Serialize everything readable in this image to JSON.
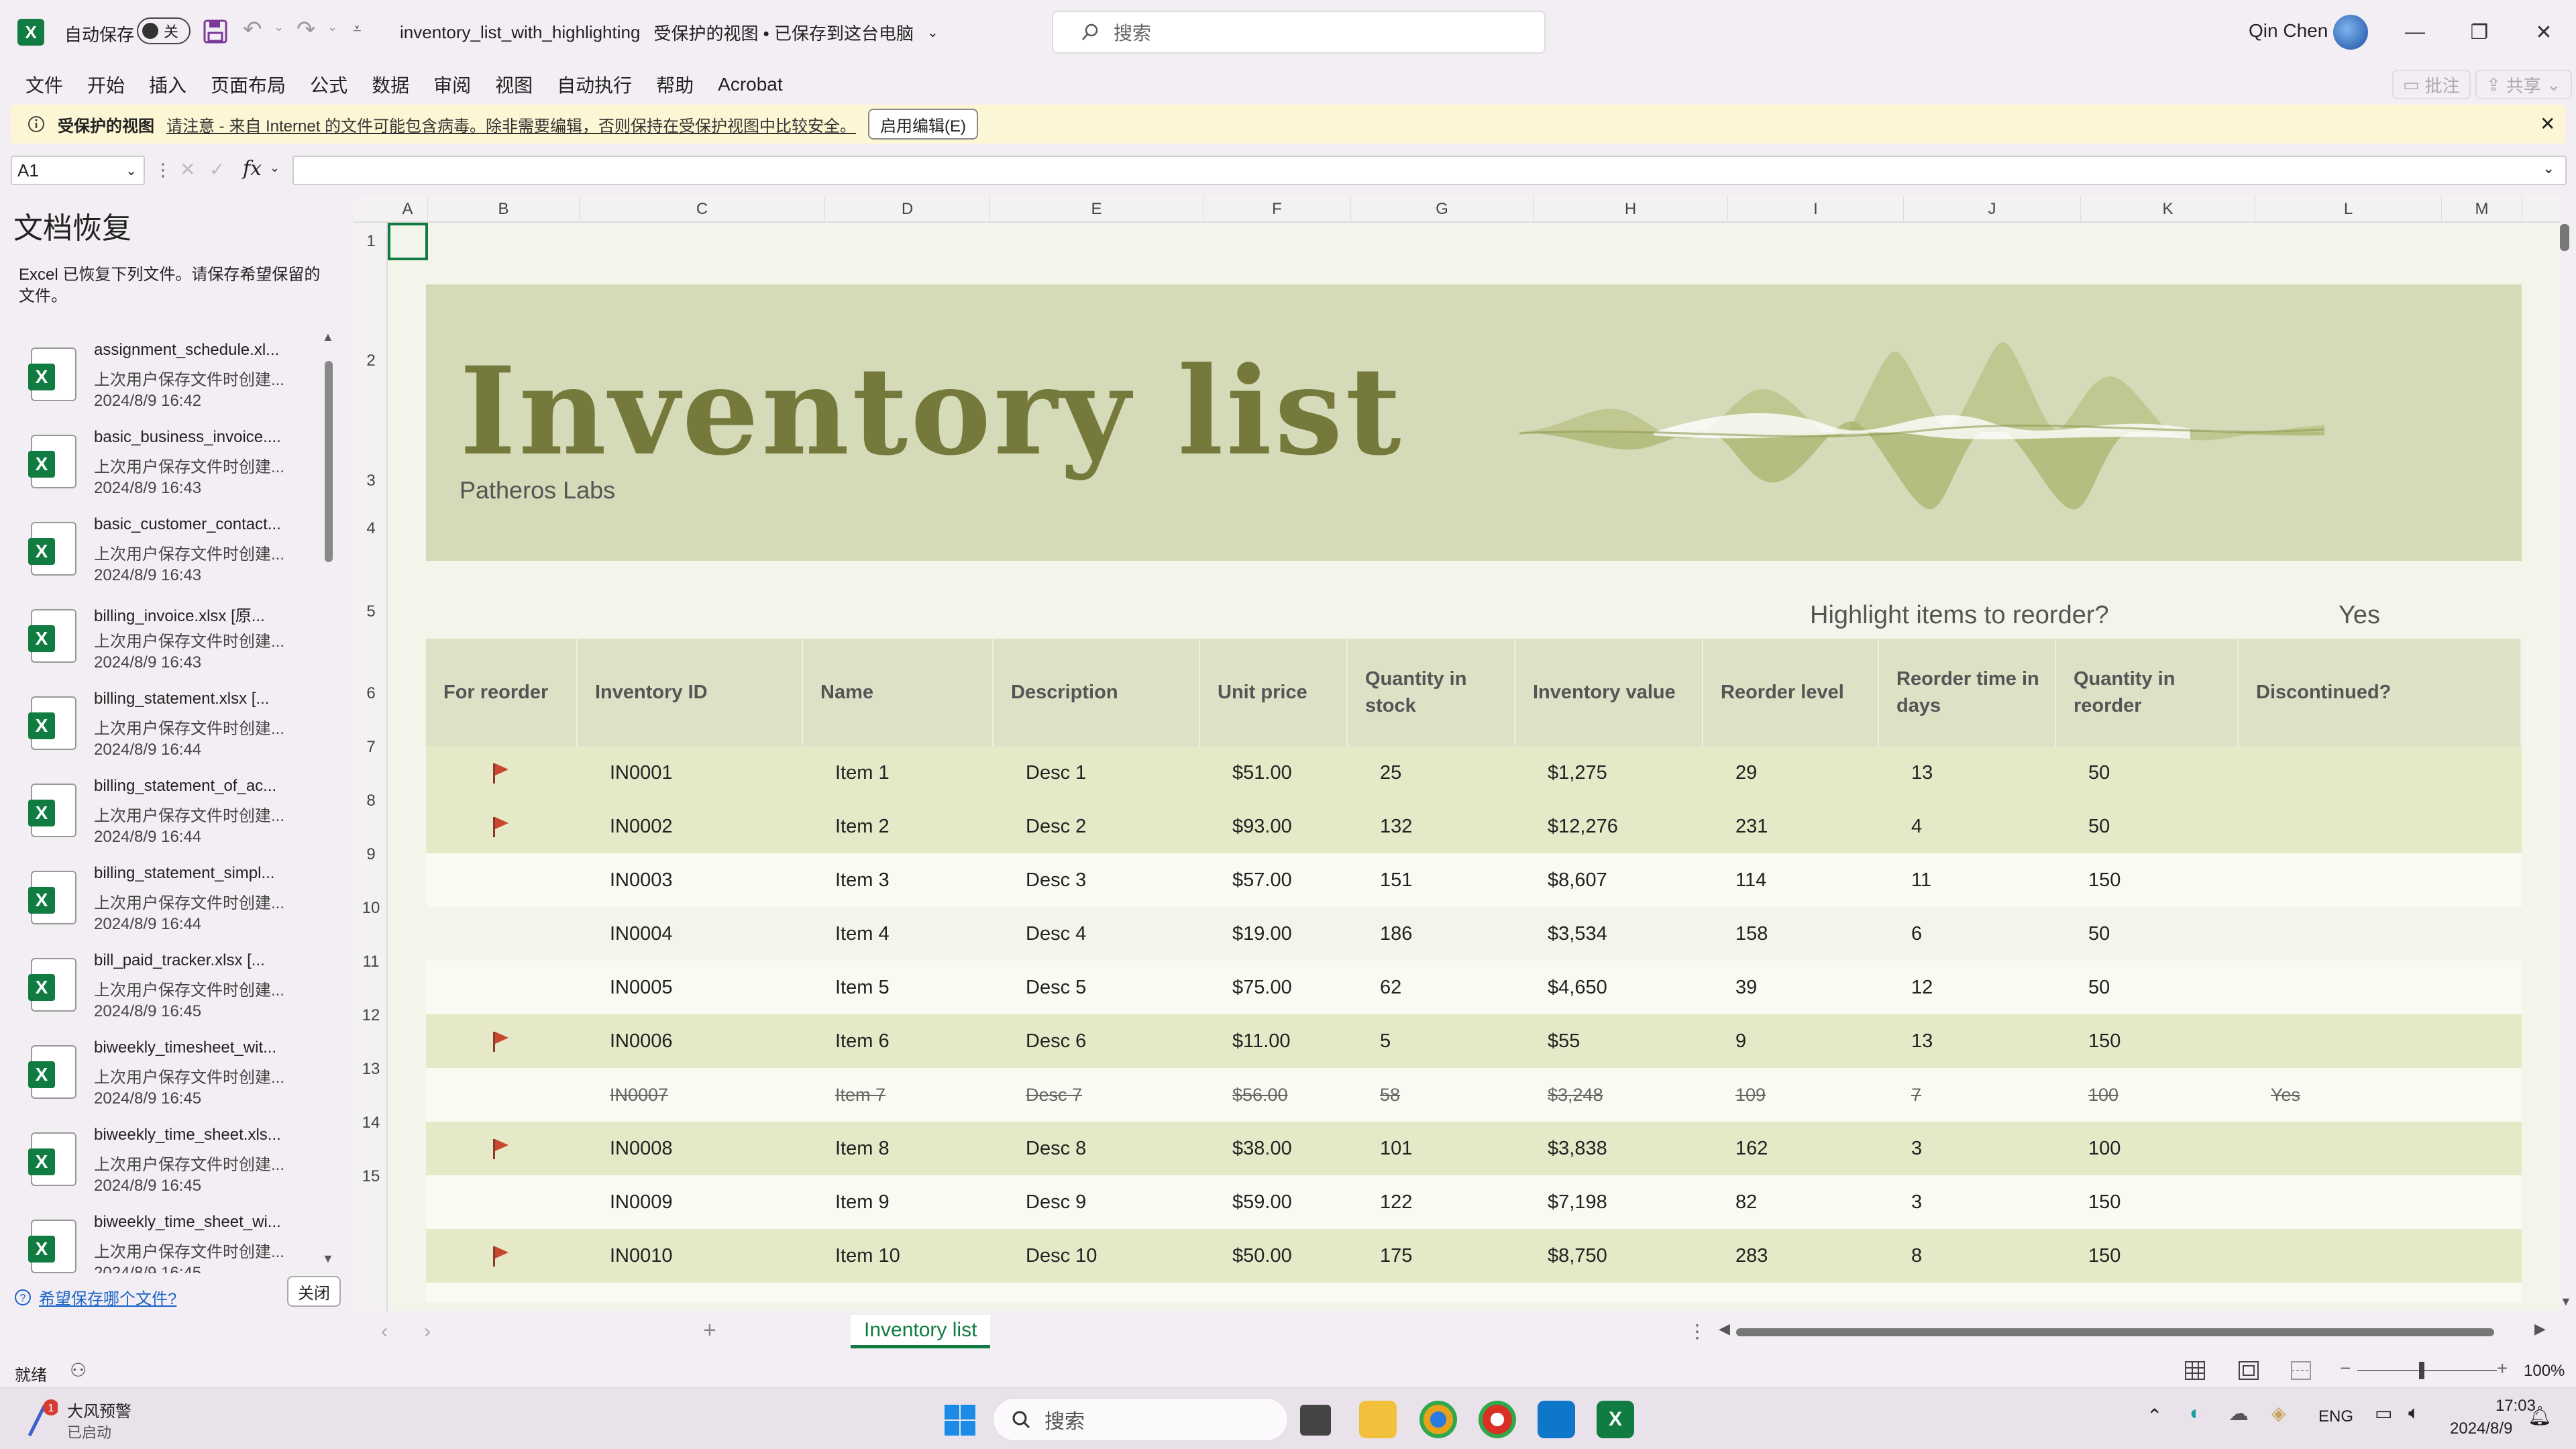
{
  "titlebar": {
    "autosave_label": "自动保存",
    "autosave_state": "关",
    "filename": "inventory_list_with_highlighting",
    "file_status": "受保护的视图 • 已保存到这台电脑",
    "search_placeholder": "搜索",
    "user_name": "Qin Chen"
  },
  "menu": {
    "items": [
      "文件",
      "开始",
      "插入",
      "页面布局",
      "公式",
      "数据",
      "审阅",
      "视图",
      "自动执行",
      "帮助",
      "Acrobat"
    ],
    "comment_label": "批注",
    "share_label": "共享"
  },
  "warning": {
    "title": "受保护的视图",
    "message": "请注意 - 来自 Internet 的文件可能包含病毒。除非需要编辑，否则保持在受保护视图中比较安全。",
    "enable_button": "启用编辑(E)"
  },
  "formula": {
    "namebox": "A1",
    "fx": "fx",
    "value": ""
  },
  "recovery": {
    "title": "文档恢复",
    "description": "Excel 已恢复下列文件。请保存希望保留的文件。",
    "files": [
      {
        "name": "assignment_schedule.xl...",
        "status": "上次用户保存文件时创建...",
        "time": "2024/8/9 16:42"
      },
      {
        "name": "basic_business_invoice....",
        "status": "上次用户保存文件时创建...",
        "time": "2024/8/9 16:43"
      },
      {
        "name": "basic_customer_contact...",
        "status": "上次用户保存文件时创建...",
        "time": "2024/8/9 16:43"
      },
      {
        "name": "billing_invoice.xlsx  [原...",
        "status": "上次用户保存文件时创建...",
        "time": "2024/8/9 16:43"
      },
      {
        "name": "billing_statement.xlsx  [...",
        "status": "上次用户保存文件时创建...",
        "time": "2024/8/9 16:44"
      },
      {
        "name": "billing_statement_of_ac...",
        "status": "上次用户保存文件时创建...",
        "time": "2024/8/9 16:44"
      },
      {
        "name": "billing_statement_simpl...",
        "status": "上次用户保存文件时创建...",
        "time": "2024/8/9 16:44"
      },
      {
        "name": "bill_paid_tracker.xlsx  [...",
        "status": "上次用户保存文件时创建...",
        "time": "2024/8/9 16:45"
      },
      {
        "name": "biweekly_timesheet_wit...",
        "status": "上次用户保存文件时创建...",
        "time": "2024/8/9 16:45"
      },
      {
        "name": "biweekly_time_sheet.xls...",
        "status": "上次用户保存文件时创建...",
        "time": "2024/8/9 16:45"
      },
      {
        "name": "biweekly_time_sheet_wi...",
        "status": "上次用户保存文件时创建...",
        "time": "2024/8/9 16:45"
      }
    ],
    "which_file_link": "希望保存哪个文件?",
    "close_button": "关闭"
  },
  "grid": {
    "columns": [
      "A",
      "B",
      "C",
      "D",
      "E",
      "F",
      "G",
      "H",
      "I",
      "J",
      "K",
      "L",
      "M"
    ],
    "rows": [
      "1",
      "2",
      "3",
      "4",
      "5",
      "6",
      "7",
      "8",
      "9",
      "10",
      "11",
      "12",
      "13",
      "14",
      "15"
    ]
  },
  "sheet": {
    "title": "Inventory list",
    "company": "Patheros Labs",
    "highlight_label": "Highlight items to reorder?",
    "highlight_value": "Yes",
    "headers": [
      "For reorder",
      "Inventory ID",
      "Name",
      "Description",
      "Unit price",
      "Quantity in stock",
      "Inventory value",
      "Reorder level",
      "Reorder time in days",
      "Quantity in reorder",
      "Discontinued?"
    ],
    "rows": [
      {
        "flag": true,
        "id": "IN0001",
        "name": "Item 1",
        "desc": "Desc 1",
        "price": "$51.00",
        "qty": "25",
        "value": "$1,275",
        "reorder_level": "29",
        "reorder_days": "13",
        "reorder_qty": "50",
        "discontinued": ""
      },
      {
        "flag": true,
        "id": "IN0002",
        "name": "Item 2",
        "desc": "Desc 2",
        "price": "$93.00",
        "qty": "132",
        "value": "$12,276",
        "reorder_level": "231",
        "reorder_days": "4",
        "reorder_qty": "50",
        "discontinued": ""
      },
      {
        "flag": false,
        "id": "IN0003",
        "name": "Item 3",
        "desc": "Desc 3",
        "price": "$57.00",
        "qty": "151",
        "value": "$8,607",
        "reorder_level": "114",
        "reorder_days": "11",
        "reorder_qty": "150",
        "discontinued": ""
      },
      {
        "flag": false,
        "id": "IN0004",
        "name": "Item 4",
        "desc": "Desc 4",
        "price": "$19.00",
        "qty": "186",
        "value": "$3,534",
        "reorder_level": "158",
        "reorder_days": "6",
        "reorder_qty": "50",
        "discontinued": ""
      },
      {
        "flag": false,
        "id": "IN0005",
        "name": "Item 5",
        "desc": "Desc 5",
        "price": "$75.00",
        "qty": "62",
        "value": "$4,650",
        "reorder_level": "39",
        "reorder_days": "12",
        "reorder_qty": "50",
        "discontinued": ""
      },
      {
        "flag": true,
        "id": "IN0006",
        "name": "Item 6",
        "desc": "Desc 6",
        "price": "$11.00",
        "qty": "5",
        "value": "$55",
        "reorder_level": "9",
        "reorder_days": "13",
        "reorder_qty": "150",
        "discontinued": ""
      },
      {
        "flag": false,
        "id": "IN0007",
        "name": "Item 7",
        "desc": "Desc 7",
        "price": "$56.00",
        "qty": "58",
        "value": "$3,248",
        "reorder_level": "109",
        "reorder_days": "7",
        "reorder_qty": "100",
        "discontinued": "Yes"
      },
      {
        "flag": true,
        "id": "IN0008",
        "name": "Item 8",
        "desc": "Desc 8",
        "price": "$38.00",
        "qty": "101",
        "value": "$3,838",
        "reorder_level": "162",
        "reorder_days": "3",
        "reorder_qty": "100",
        "discontinued": ""
      },
      {
        "flag": false,
        "id": "IN0009",
        "name": "Item 9",
        "desc": "Desc 9",
        "price": "$59.00",
        "qty": "122",
        "value": "$7,198",
        "reorder_level": "82",
        "reorder_days": "3",
        "reorder_qty": "150",
        "discontinued": ""
      },
      {
        "flag": true,
        "id": "IN0010",
        "name": "Item 10",
        "desc": "Desc 10",
        "price": "$50.00",
        "qty": "175",
        "value": "$8,750",
        "reorder_level": "283",
        "reorder_days": "8",
        "reorder_qty": "150",
        "discontinued": ""
      }
    ]
  },
  "tabs": {
    "sheet_name": "Inventory list",
    "add": "+"
  },
  "status": {
    "ready": "就绪",
    "zoom": "100%"
  },
  "taskbar": {
    "weather_title": "大风预警",
    "weather_sub": "已启动",
    "search_placeholder": "搜索",
    "lang": "ENG",
    "time": "17:03",
    "date": "2024/8/9"
  },
  "colors": {
    "excel_green": "#107c41",
    "banner": "#d5dab8",
    "title_olive": "#757a3c",
    "highlight_row": "#e5e9c8",
    "flag_red": "#c9472e"
  }
}
